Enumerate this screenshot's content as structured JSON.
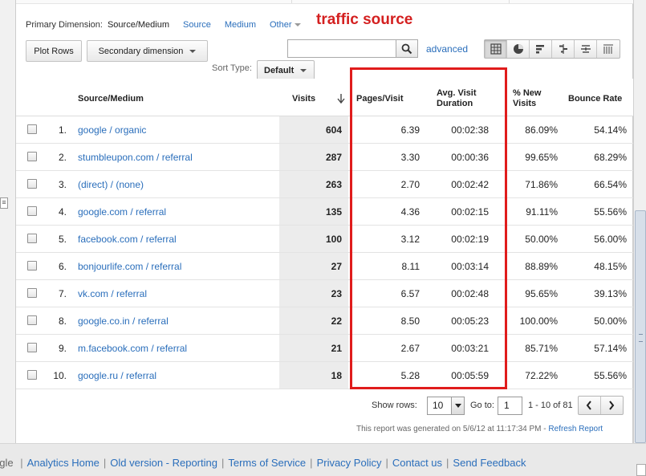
{
  "primary_dimension": {
    "label": "Primary Dimension:",
    "active": "Source/Medium",
    "options": [
      "Source",
      "Medium"
    ],
    "other": "Other"
  },
  "annotation": "traffic source",
  "toolbar": {
    "plot_rows": "Plot Rows",
    "secondary_dimension": "Secondary dimension",
    "search_placeholder": "",
    "advanced": "advanced",
    "views": [
      "table-view-icon",
      "pie-view-icon",
      "performance-view-icon",
      "comparison-view-icon",
      "term-cloud-view-icon",
      "pivot-view-icon"
    ]
  },
  "sort": {
    "label": "Sort Type:",
    "value": "Default"
  },
  "table": {
    "headers": {
      "source": "Source/Medium",
      "visits": "Visits",
      "pages": "Pages/Visit",
      "duration_1": "Avg. Visit",
      "duration_2": "Duration",
      "new_1": "% New",
      "new_2": "Visits",
      "bounce": "Bounce Rate"
    },
    "rows": [
      {
        "n": "1.",
        "source": "google / organic",
        "visits": "604",
        "pages": "6.39",
        "duration": "00:02:38",
        "new": "86.09%",
        "bounce": "54.14%"
      },
      {
        "n": "2.",
        "source": "stumbleupon.com / referral",
        "visits": "287",
        "pages": "3.30",
        "duration": "00:00:36",
        "new": "99.65%",
        "bounce": "68.29%"
      },
      {
        "n": "3.",
        "source": "(direct) / (none)",
        "visits": "263",
        "pages": "2.70",
        "duration": "00:02:42",
        "new": "71.86%",
        "bounce": "66.54%"
      },
      {
        "n": "4.",
        "source": "google.com / referral",
        "visits": "135",
        "pages": "4.36",
        "duration": "00:02:15",
        "new": "91.11%",
        "bounce": "55.56%"
      },
      {
        "n": "5.",
        "source": "facebook.com / referral",
        "visits": "100",
        "pages": "3.12",
        "duration": "00:02:19",
        "new": "50.00%",
        "bounce": "56.00%"
      },
      {
        "n": "6.",
        "source": "bonjourlife.com / referral",
        "visits": "27",
        "pages": "8.11",
        "duration": "00:03:14",
        "new": "88.89%",
        "bounce": "48.15%"
      },
      {
        "n": "7.",
        "source": "vk.com / referral",
        "visits": "23",
        "pages": "6.57",
        "duration": "00:02:48",
        "new": "95.65%",
        "bounce": "39.13%"
      },
      {
        "n": "8.",
        "source": "google.co.in / referral",
        "visits": "22",
        "pages": "8.50",
        "duration": "00:05:23",
        "new": "100.00%",
        "bounce": "50.00%"
      },
      {
        "n": "9.",
        "source": "m.facebook.com / referral",
        "visits": "21",
        "pages": "2.67",
        "duration": "00:03:21",
        "new": "85.71%",
        "bounce": "57.14%"
      },
      {
        "n": "10.",
        "source": "google.ru / referral",
        "visits": "18",
        "pages": "5.28",
        "duration": "00:05:59",
        "new": "72.22%",
        "bounce": "55.56%"
      }
    ]
  },
  "pagination": {
    "show_rows_label": "Show rows:",
    "show_rows_value": "10",
    "goto_label": "Go to:",
    "goto_value": "1",
    "range": "1 - 10 of 81"
  },
  "generated": {
    "text": "This report was generated on 5/6/12 at 11:17:34 PM - ",
    "refresh": "Refresh Report"
  },
  "footer": {
    "prefix": "ogle",
    "links": [
      "Analytics Home",
      "Old version - Reporting",
      "Terms of Service",
      "Privacy Policy",
      "Contact us",
      "Send Feedback"
    ]
  },
  "colors": {
    "link": "#2a6ebb",
    "annotation": "#d42020",
    "highlight_box": "#e01c1c",
    "visits_column": "#ececec"
  }
}
